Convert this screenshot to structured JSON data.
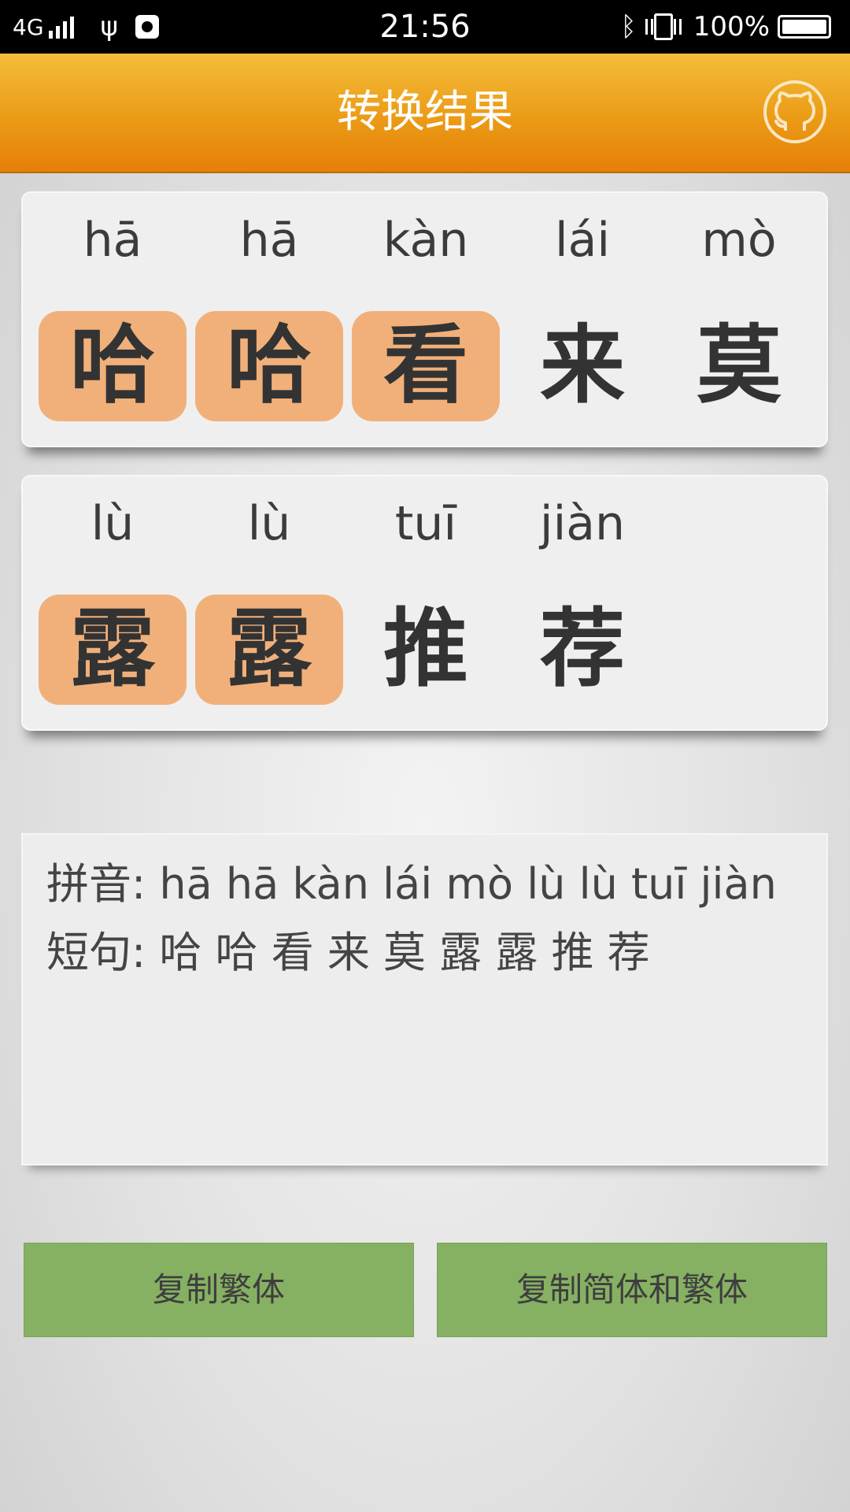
{
  "status_bar": {
    "network": "4G",
    "time": "21:56",
    "battery": "100%",
    "icons": [
      "signal-icon",
      "usb-icon",
      "debug-icon",
      "bluetooth-icon",
      "vibrate-icon",
      "battery-icon"
    ]
  },
  "header": {
    "title": "转换结果",
    "right_icon": "github-icon"
  },
  "cards": [
    {
      "items": [
        {
          "pinyin": "hā",
          "hanzi": "哈",
          "highlighted": true
        },
        {
          "pinyin": "hā",
          "hanzi": "哈",
          "highlighted": true
        },
        {
          "pinyin": "kàn",
          "hanzi": "看",
          "highlighted": true
        },
        {
          "pinyin": "lái",
          "hanzi": "来",
          "highlighted": false
        },
        {
          "pinyin": "mò",
          "hanzi": "莫",
          "highlighted": false
        }
      ]
    },
    {
      "items": [
        {
          "pinyin": "lù",
          "hanzi": "露",
          "highlighted": true
        },
        {
          "pinyin": "lù",
          "hanzi": "露",
          "highlighted": true
        },
        {
          "pinyin": "tuī",
          "hanzi": "推",
          "highlighted": false
        },
        {
          "pinyin": "jiàn",
          "hanzi": "荐",
          "highlighted": false
        }
      ]
    }
  ],
  "result": {
    "pinyin_line": "拼音: hā hā kàn lái mò lù lù tuī jiàn",
    "sentence_line": "短句: 哈 哈 看 来 莫 露 露 推 荐"
  },
  "buttons": {
    "copy_traditional": "复制繁体",
    "copy_both": "复制简体和繁体"
  },
  "colors": {
    "header_top": "#f4bd3a",
    "header_bottom": "#e67f08",
    "highlight": "#f1b07a",
    "button": "#86b163"
  }
}
